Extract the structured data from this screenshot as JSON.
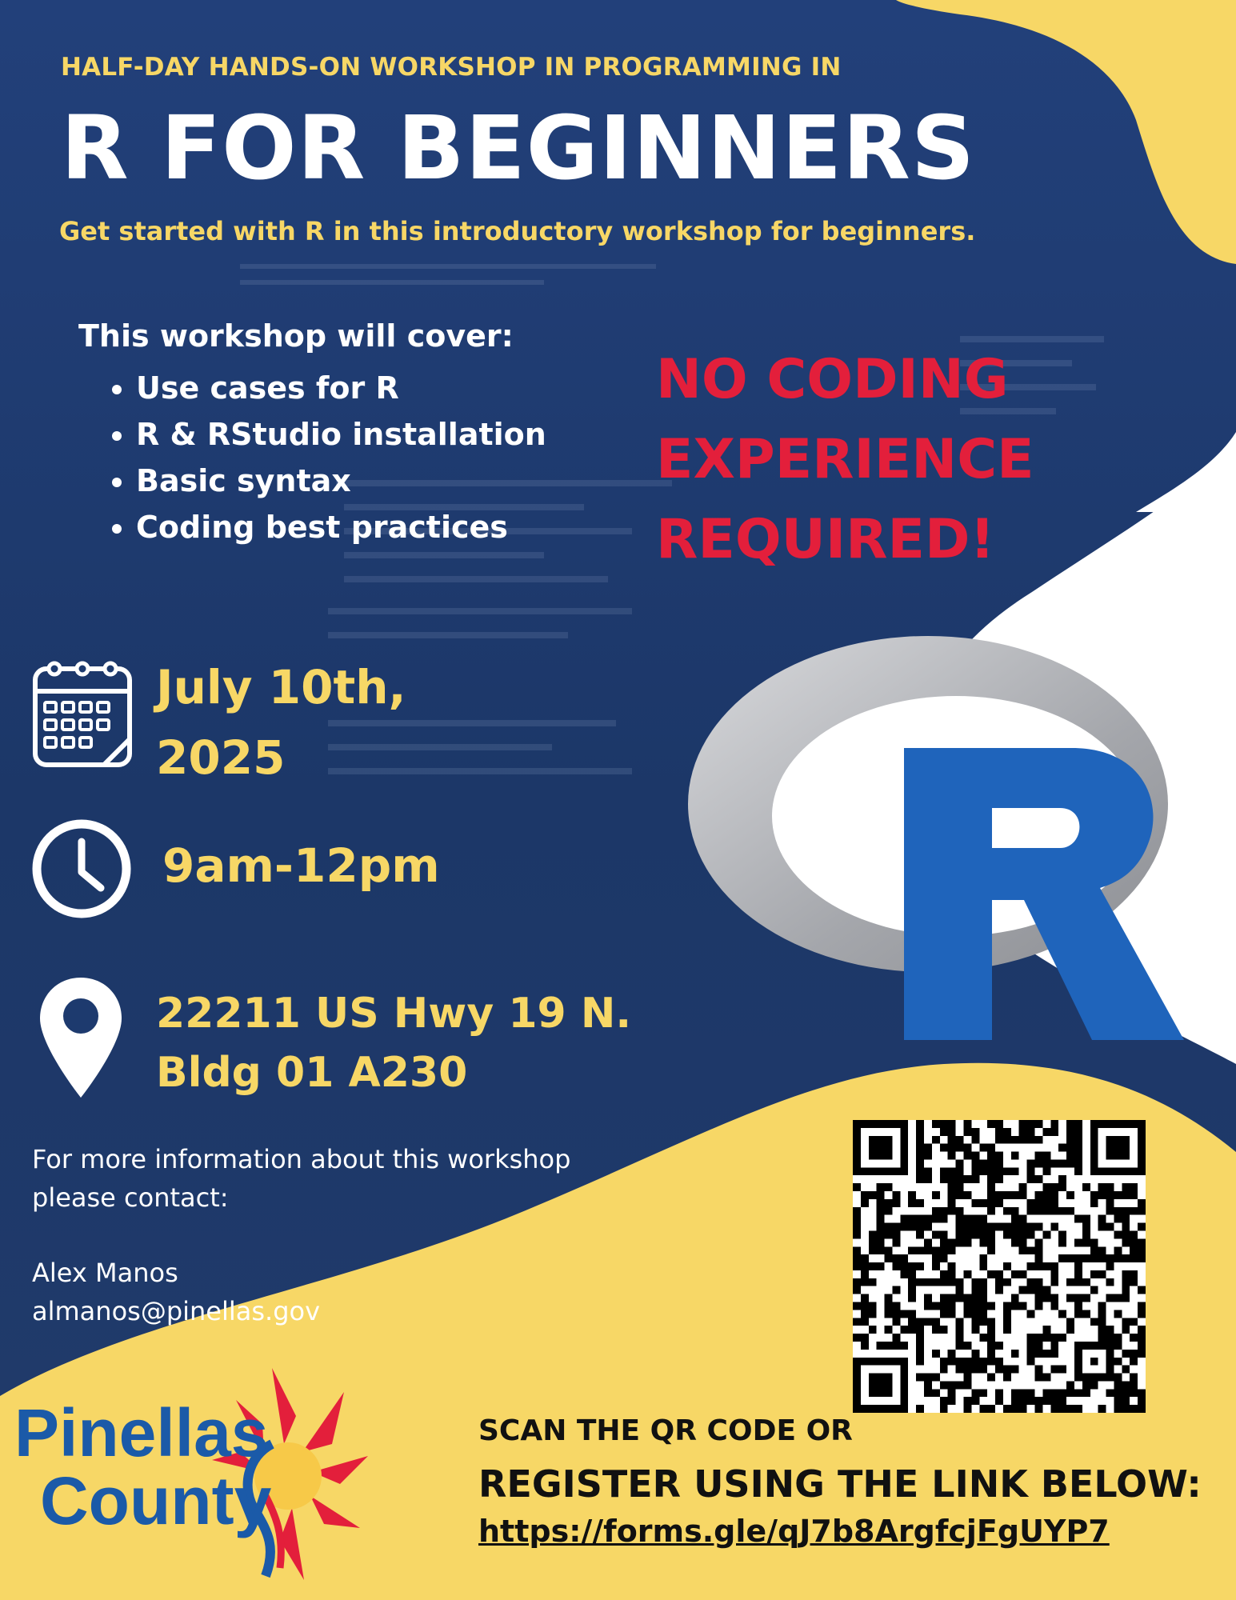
{
  "header": {
    "eyebrow": "HALF-DAY HANDS-ON WORKSHOP IN PROGRAMMING IN",
    "title": "R FOR BEGINNERS",
    "subtitle": "Get started with R in this introductory workshop for beginners."
  },
  "cover": {
    "heading": "This workshop will cover:",
    "items": [
      "Use cases for R",
      "R & RStudio installation",
      "Basic syntax",
      "Coding best practices"
    ]
  },
  "callout": {
    "lines": [
      "NO CODING",
      "EXPERIENCE",
      "REQUIRED!"
    ]
  },
  "details": {
    "date_line1": "July 10th,",
    "date_line2": "2025",
    "time": "9am-12pm",
    "address_line1": "22211 US Hwy 19 N.",
    "address_line2": "Bldg 01 A230"
  },
  "contact": {
    "line1": "For more information about this workshop",
    "line2": "please contact:",
    "name": "Alex Manos",
    "email": "almanos@pinellas.gov"
  },
  "register": {
    "line1": "SCAN THE QR CODE OR",
    "line2": "REGISTER USING THE LINK BELOW:",
    "link": "https://forms.gle/qJ7b8ArgfcjFgUYP7"
  },
  "logo": {
    "line1": "Pinellas",
    "line2": "County"
  },
  "icons": [
    "calendar-icon",
    "clock-icon",
    "location-pin-icon",
    "r-logo-icon",
    "qr-code",
    "sun-icon"
  ],
  "colors": {
    "navy": "#1d3a6e",
    "yellow": "#f7d766",
    "red": "#e31f3b",
    "r_blue": "#1f64bb",
    "logo_blue": "#1b5aa8"
  }
}
